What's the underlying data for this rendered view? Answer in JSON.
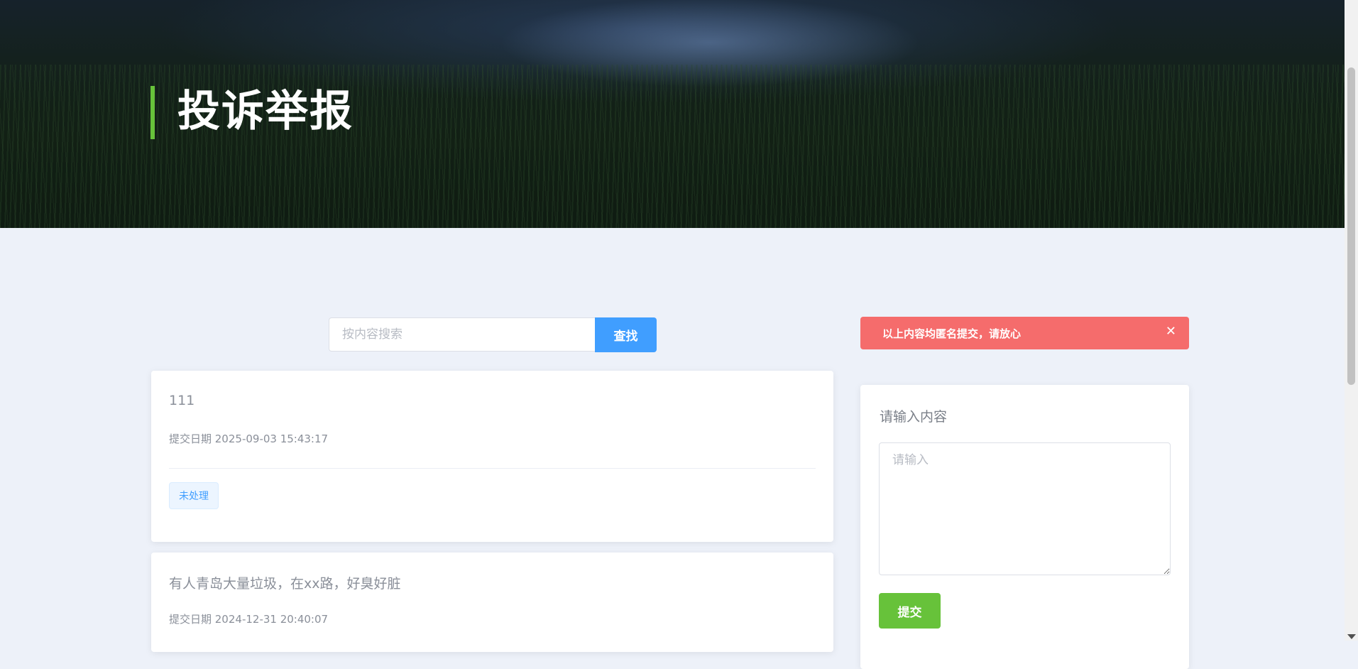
{
  "hero": {
    "title": "投诉举报"
  },
  "search": {
    "placeholder": "按内容搜索",
    "button_label": "查找"
  },
  "complaints": [
    {
      "content": "111",
      "date_label": "提交日期 2025-09-03 15:43:17",
      "status": "未处理"
    },
    {
      "content": "有人青岛大量垃圾，在xx路，好臭好脏",
      "date_label": "提交日期 2024-12-31 20:40:07"
    }
  ],
  "alert": {
    "message": "以上内容均匿名提交，请放心",
    "close_glyph": "✕"
  },
  "form": {
    "label": "请输入内容",
    "placeholder": "请输入",
    "submit_label": "提交"
  },
  "colors": {
    "accent": "#67c23a",
    "primary": "#409eff",
    "danger": "#f56c6c",
    "page_bg": "#edf1f9"
  }
}
